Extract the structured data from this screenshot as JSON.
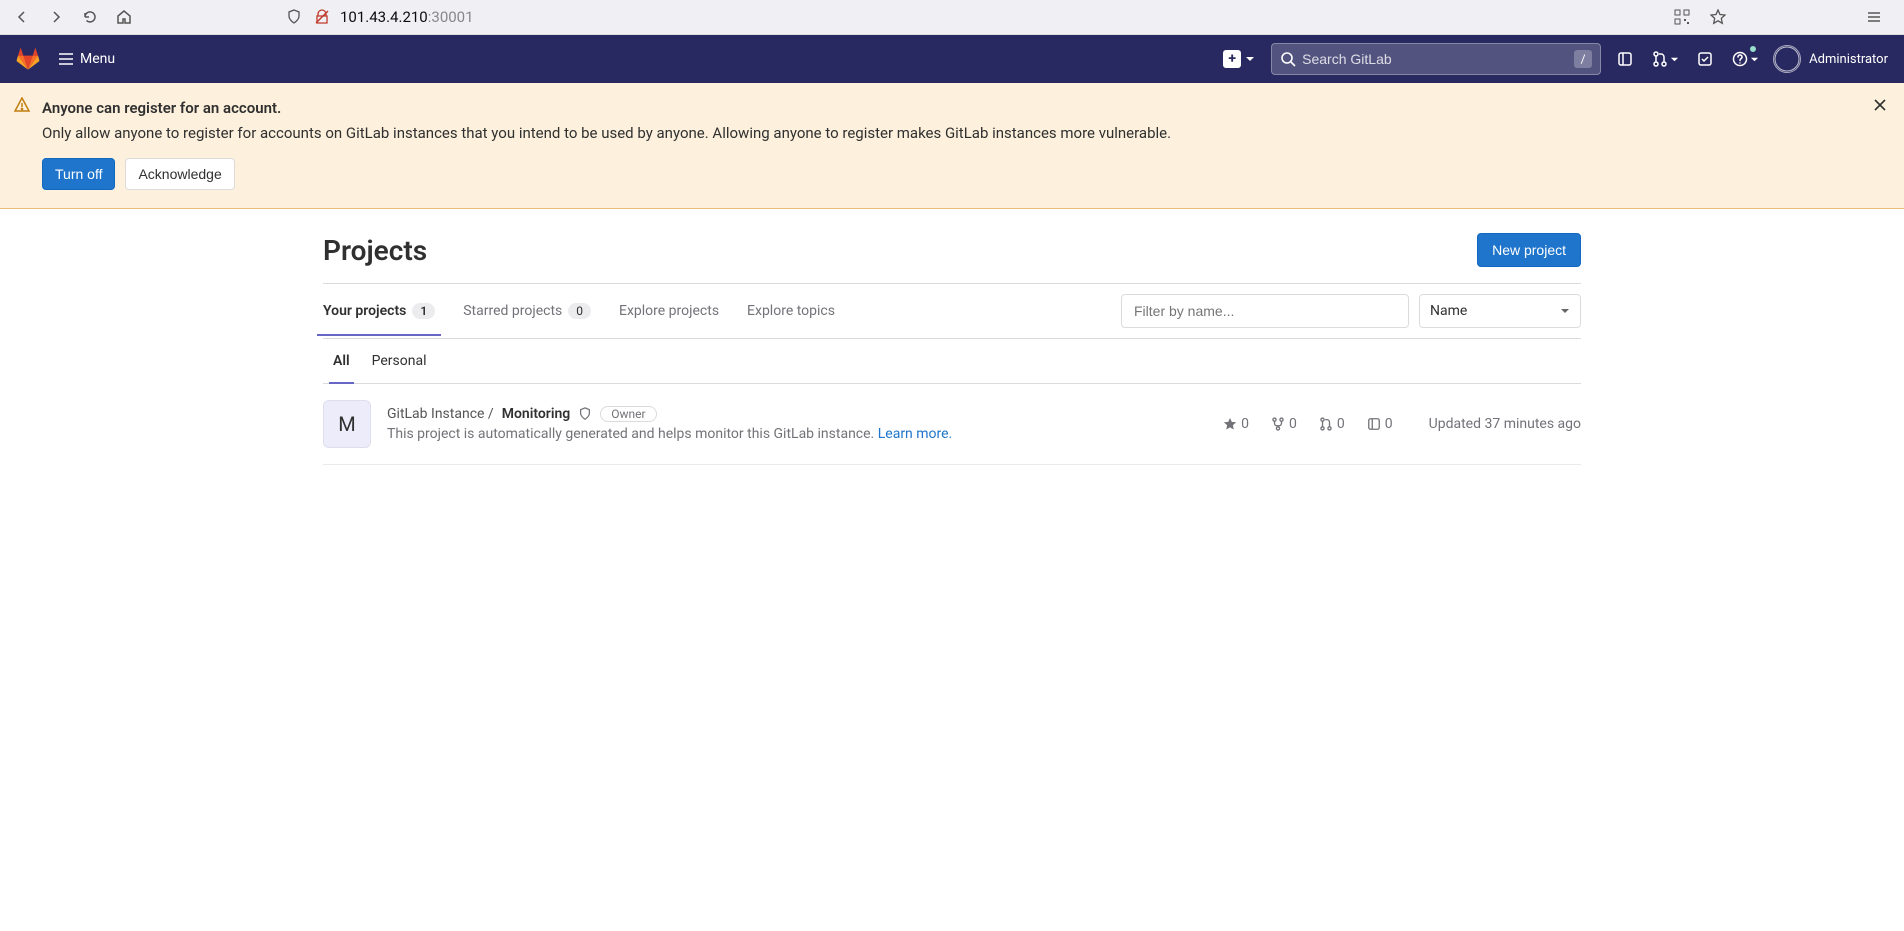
{
  "browser": {
    "url_host": "101.43.4.210",
    "url_port": ":30001"
  },
  "header": {
    "menu_label": "Menu",
    "search_placeholder": "Search GitLab",
    "search_kbd": "/",
    "user_label": "Administrator"
  },
  "alert": {
    "title": "Anyone can register for an account.",
    "body": "Only allow anyone to register for accounts on GitLab instances that you intend to be used by anyone. Allowing anyone to register makes GitLab instances more vulnerable.",
    "turn_off": "Turn off",
    "acknowledge": "Acknowledge"
  },
  "page": {
    "title": "Projects",
    "new_project": "New project"
  },
  "tabs": {
    "your_projects": "Your projects",
    "your_projects_count": "1",
    "starred_projects": "Starred projects",
    "starred_projects_count": "0",
    "explore_projects": "Explore projects",
    "explore_topics": "Explore topics"
  },
  "filter": {
    "placeholder": "Filter by name...",
    "sort_label": "Name"
  },
  "subtabs": {
    "all": "All",
    "personal": "Personal"
  },
  "project": {
    "avatar_letter": "M",
    "namespace": "GitLab Instance /",
    "name": "Monitoring",
    "owner_badge": "Owner",
    "description": "This project is automatically generated and helps monitor this GitLab instance. ",
    "learn_more": "Learn more.",
    "stars": "0",
    "forks": "0",
    "merge_requests": "0",
    "issues": "0",
    "updated_prefix": "Updated ",
    "updated_time": "37 minutes ago"
  }
}
